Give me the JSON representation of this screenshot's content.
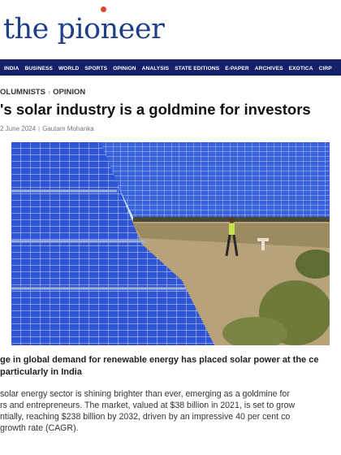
{
  "masthead": {
    "logo_text": "the pioneer",
    "brand_color": "#1d3f8a",
    "accent_color": "#e1442b"
  },
  "nav": {
    "bg_color": "#14206a",
    "items": [
      "INDIA",
      "BUSINESS",
      "WORLD",
      "SPORTS",
      "OPINION",
      "ANALYSIS",
      "STATE EDITIONS",
      "E-PAPER",
      "ARCHIVES",
      "EXOTICA",
      "CIRP"
    ]
  },
  "breadcrumb": {
    "section": "OLUMNISTS",
    "separator": "›",
    "subsection": "OPINION"
  },
  "article": {
    "headline": "'s solar industry is a goldmine for investors",
    "date": "2 June 2024",
    "author": "Gautam Mohanka",
    "summary_lines": [
      "ge in global demand for renewable energy has placed solar power at the ce",
      "particularly in India"
    ],
    "body_lines": [
      "solar energy sector is shining brighter than ever, emerging as a goldmine for",
      "rs and entrepreneurs. The market, valued at $38 billion in 2021, is set to grow",
      "ntially, reaching $238 billion by 2032, driven by an impressive 40 per cent co",
      "growth rate (CAGR)."
    ]
  },
  "hero_image": {
    "icon": "solar-farm-photo",
    "panel_color": "#2f55d6",
    "sky_color": "#cfe3f5",
    "ground_color": "#b7a27a"
  }
}
